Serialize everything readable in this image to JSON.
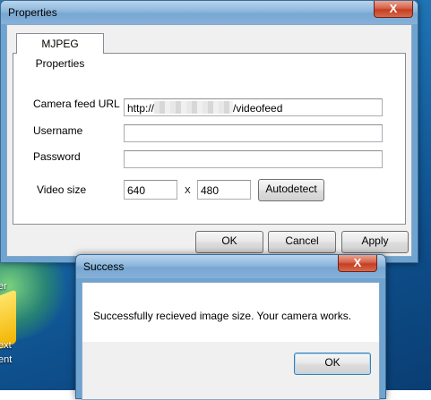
{
  "desktop": {
    "label_1": "er",
    "label_2": "ext",
    "label_3": "ent"
  },
  "properties": {
    "title": "Properties",
    "close_glyph": "X",
    "tab_label": "MJPEG Properties",
    "url_label": "Camera feed URL",
    "url_prefix": "http://",
    "url_suffix": "/videofeed",
    "username_label": "Username",
    "username_value": "",
    "password_label": "Password",
    "password_value": "",
    "video_size_label": "Video size",
    "width_value": "640",
    "x_separator": "X",
    "height_value": "480",
    "autodetect_label": "Autodetect",
    "ok_label": "OK",
    "cancel_label": "Cancel",
    "apply_label": "Apply"
  },
  "success": {
    "title": "Success",
    "close_glyph": "X",
    "message": "Successfully recieved image size. Your camera works.",
    "ok_label": "OK"
  }
}
